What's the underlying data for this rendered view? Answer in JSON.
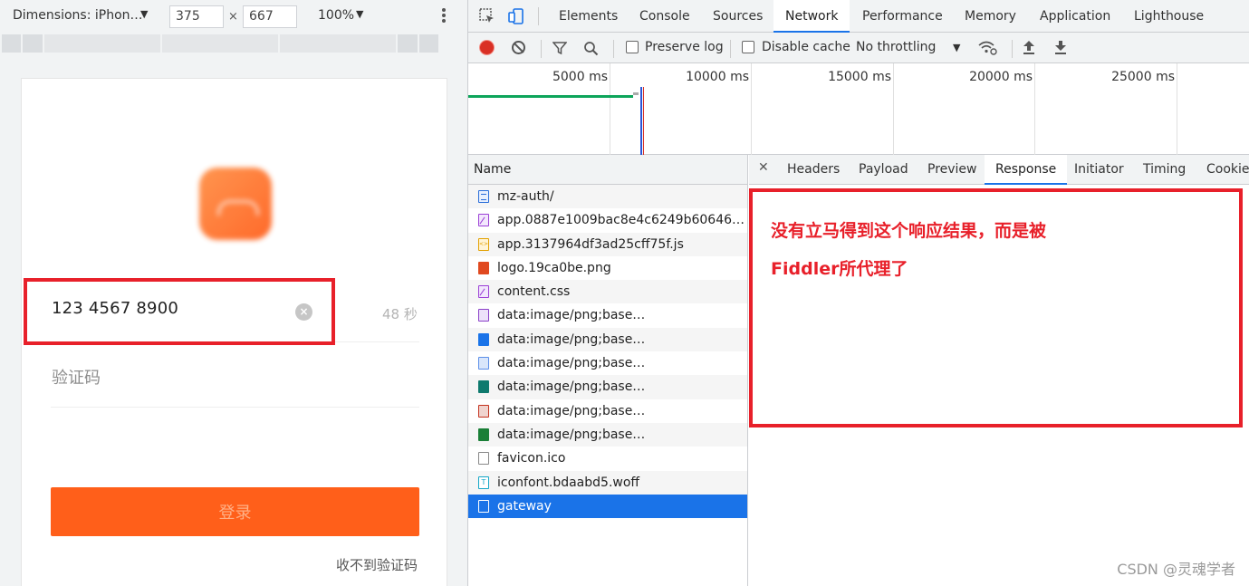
{
  "device_toolbar": {
    "dimensions_label": "Dimensions: iPhon…",
    "width": "375",
    "times": "×",
    "height": "667",
    "zoom": "100%",
    "caret": "▼"
  },
  "mobile_page": {
    "phone_number": "123 4567 8900",
    "countdown": "48 秒",
    "code_placeholder": "验证码",
    "login_button": "登录",
    "no_code_link": "收不到验证码"
  },
  "devtools": {
    "tabs": [
      {
        "label": "Elements"
      },
      {
        "label": "Console"
      },
      {
        "label": "Sources"
      },
      {
        "label": "Network"
      },
      {
        "label": "Performance"
      },
      {
        "label": "Memory"
      },
      {
        "label": "Application"
      },
      {
        "label": "Lighthouse"
      }
    ],
    "active_tab": "Network",
    "network_toolbar": {
      "preserve_log": "Preserve log",
      "disable_cache": "Disable cache",
      "throttling": "No throttling"
    },
    "timeline_labels": [
      "5000 ms",
      "10000 ms",
      "15000 ms",
      "20000 ms",
      "25000 ms"
    ],
    "requests_header": "Name",
    "requests": [
      {
        "name": "mz-auth/",
        "icon": "document-icon"
      },
      {
        "name": "app.0887e1009bac8e4c6249b6064624…",
        "icon": "css-icon"
      },
      {
        "name": "app.3137964df3ad25cff75f.js",
        "icon": "js-icon"
      },
      {
        "name": "logo.19ca0be.png",
        "icon": "image-icon"
      },
      {
        "name": "content.css",
        "icon": "css-icon"
      },
      {
        "name": "data:image/png;base…",
        "icon": "image-icon"
      },
      {
        "name": "data:image/png;base…",
        "icon": "image-icon"
      },
      {
        "name": "data:image/png;base…",
        "icon": "image-icon"
      },
      {
        "name": "data:image/png;base…",
        "icon": "image-icon"
      },
      {
        "name": "data:image/png;base…",
        "icon": "image-icon"
      },
      {
        "name": "data:image/png;base…",
        "icon": "image-icon"
      },
      {
        "name": "favicon.ico",
        "icon": "file-icon"
      },
      {
        "name": "iconfont.bdaabd5.woff",
        "icon": "font-icon"
      },
      {
        "name": "gateway",
        "icon": "file-icon",
        "selected": true
      }
    ],
    "detail_tabs": [
      {
        "label": "Headers"
      },
      {
        "label": "Payload"
      },
      {
        "label": "Preview"
      },
      {
        "label": "Response"
      },
      {
        "label": "Initiator"
      },
      {
        "label": "Timing"
      },
      {
        "label": "Cookies"
      }
    ],
    "active_detail_tab": "Response",
    "close_symbol": "✕"
  },
  "annotation": {
    "line1": "没有立马得到这个响应结果，而是被",
    "line2": "Fiddler所代理了"
  },
  "watermark": "CSDN @灵魂学者",
  "colors": {
    "accent": "#1a73e8",
    "highlight_red": "#e8202a",
    "login_orange": "#ff5f1a",
    "record_red": "#d93025"
  }
}
